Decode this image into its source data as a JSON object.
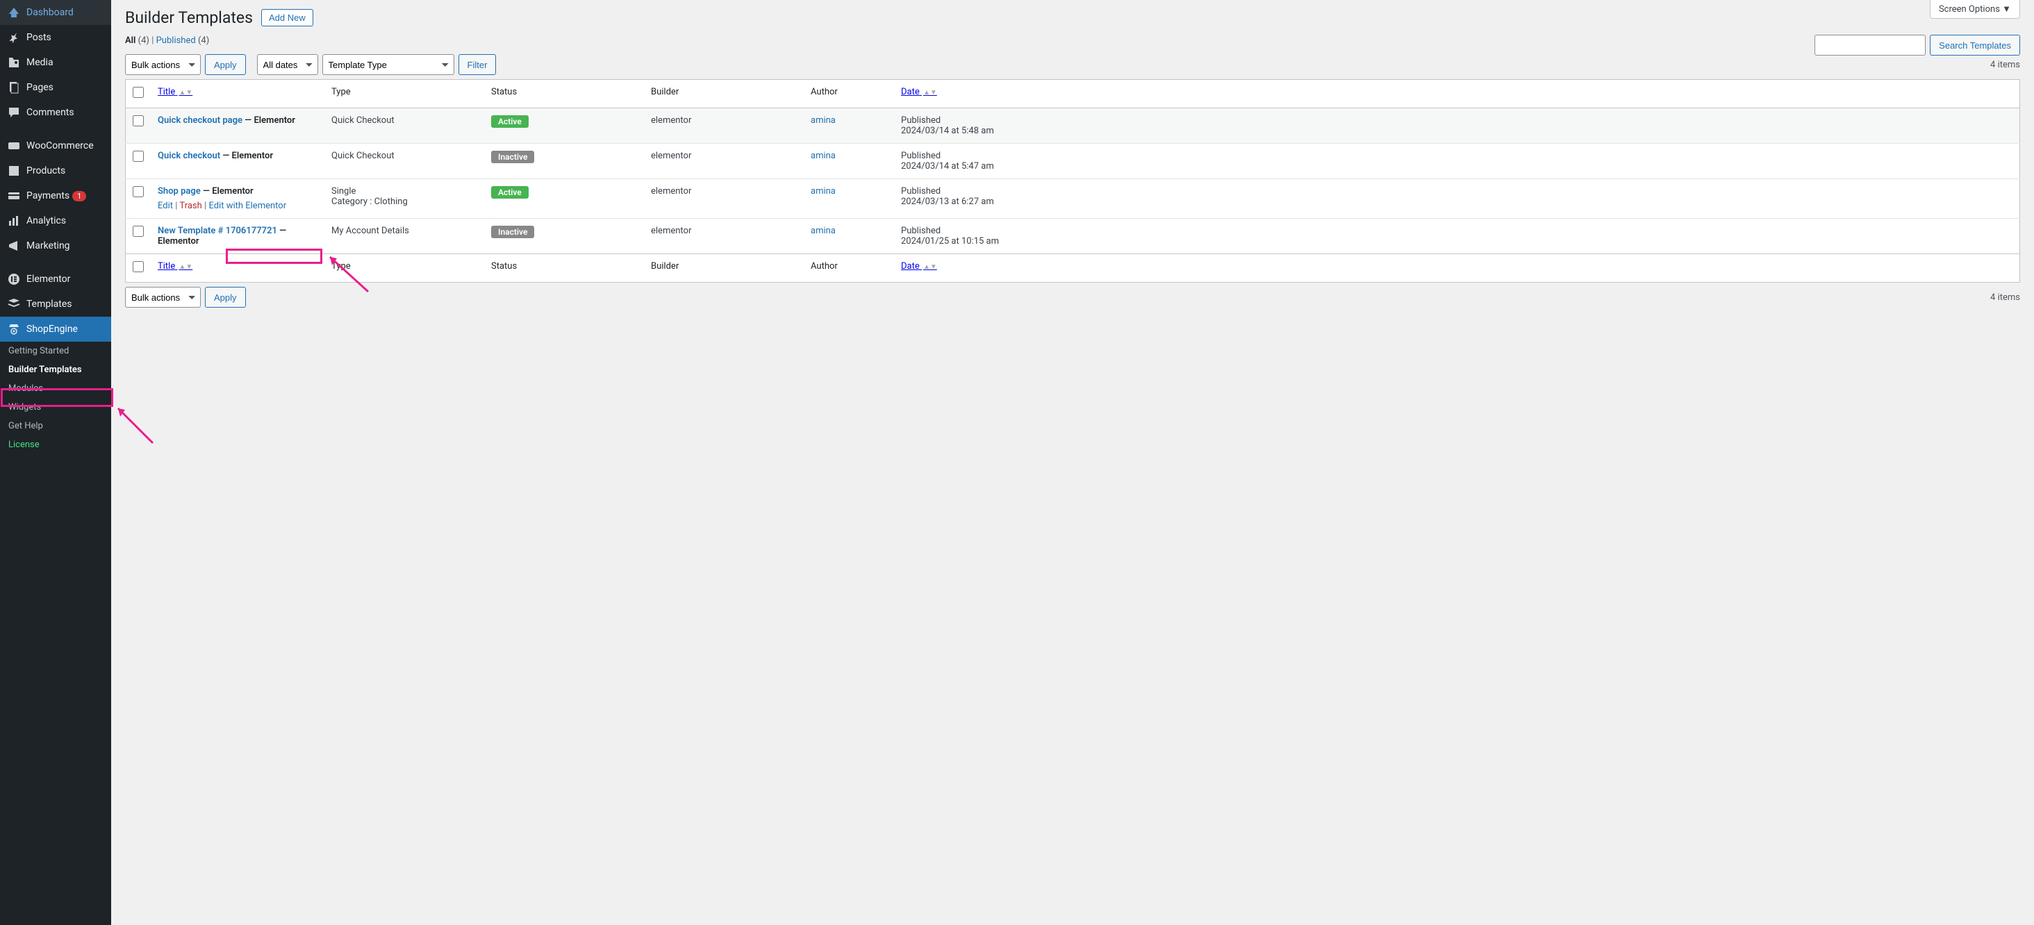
{
  "sidebar": {
    "items": [
      {
        "label": "Dashboard",
        "icon": "dashboard"
      },
      {
        "label": "Posts",
        "icon": "pin"
      },
      {
        "label": "Media",
        "icon": "media"
      },
      {
        "label": "Pages",
        "icon": "pages"
      },
      {
        "label": "Comments",
        "icon": "comments"
      },
      {
        "label": "WooCommerce",
        "icon": "woo"
      },
      {
        "label": "Products",
        "icon": "products"
      },
      {
        "label": "Payments",
        "icon": "payments",
        "badge": "1"
      },
      {
        "label": "Analytics",
        "icon": "analytics"
      },
      {
        "label": "Marketing",
        "icon": "marketing"
      },
      {
        "label": "Elementor",
        "icon": "elementor"
      },
      {
        "label": "Templates",
        "icon": "templates"
      },
      {
        "label": "ShopEngine",
        "icon": "shopengine",
        "active": true
      }
    ],
    "submenu": [
      {
        "label": "Getting Started"
      },
      {
        "label": "Builder Templates",
        "current": true
      },
      {
        "label": "Modules"
      },
      {
        "label": "Widgets"
      },
      {
        "label": "Get Help"
      },
      {
        "label": "License",
        "license": true
      }
    ]
  },
  "screen_options": "Screen Options  ▼",
  "page_title": "Builder Templates",
  "add_new": "Add New",
  "filters": {
    "all_label": "All",
    "all_count": "(4)",
    "published_label": "Published",
    "published_count": "(4)"
  },
  "search_button": "Search Templates",
  "bulk_actions": "Bulk actions",
  "apply_label": "Apply",
  "all_dates": "All dates",
  "template_type": "Template Type",
  "filter_label": "Filter",
  "items_count": "4 items",
  "columns": {
    "title": "Title",
    "type": "Type",
    "status": "Status",
    "builder": "Builder",
    "author": "Author",
    "date": "Date"
  },
  "rows": [
    {
      "title": "Quick checkout page",
      "builder_suffix": " — Elementor",
      "type": "Quick Checkout",
      "subtype": "",
      "status": "Active",
      "status_class": "active",
      "builder": "elementor",
      "author": "amina",
      "date_label": "Published",
      "date_value": "2024/03/14 at 5:48 am",
      "hovered": true
    },
    {
      "title": "Quick checkout",
      "builder_suffix": " — Elementor",
      "type": "Quick Checkout",
      "subtype": "",
      "status": "Inactive",
      "status_class": "inactive",
      "builder": "elementor",
      "author": "amina",
      "date_label": "Published",
      "date_value": "2024/03/14 at 5:47 am"
    },
    {
      "title": "Shop page",
      "builder_suffix": " — Elementor",
      "type": "Single",
      "subtype": "Category : Clothing",
      "status": "Active",
      "status_class": "active",
      "builder": "elementor",
      "author": "amina",
      "date_label": "Published",
      "date_value": "2024/03/13 at 6:27 am",
      "show_actions": true
    },
    {
      "title": "New Template # 1706177721",
      "builder_suffix": " — Elementor",
      "type": "My Account Details",
      "subtype": "",
      "status": "Inactive",
      "status_class": "inactive",
      "builder": "elementor",
      "author": "amina",
      "date_label": "Published",
      "date_value": "2024/01/25 at 10:15 am"
    }
  ],
  "row_actions": {
    "edit": "Edit",
    "trash": "Trash",
    "edit_elementor": "Edit with Elementor"
  }
}
